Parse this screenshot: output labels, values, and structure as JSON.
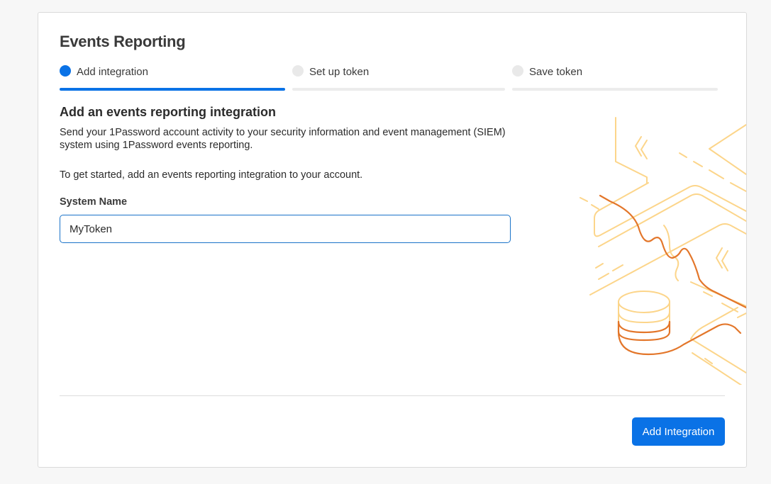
{
  "page": {
    "title": "Events Reporting"
  },
  "stepper": {
    "steps": [
      {
        "label": "Add integration",
        "state": "active"
      },
      {
        "label": "Set up token",
        "state": "pending"
      },
      {
        "label": "Save token",
        "state": "pending"
      }
    ]
  },
  "main": {
    "heading": "Add an events reporting integration",
    "description": "Send your 1Password account activity to your security information and event management (SIEM) system using 1Password events reporting.",
    "instruction": "To get started, add an events reporting integration to your account.",
    "system_name_label": "System Name",
    "system_name_value": "MyToken"
  },
  "footer": {
    "primary_button_label": "Add Integration"
  },
  "colors": {
    "accent": "#0a72e6",
    "illustration_light": "#fcd58a",
    "illustration_dark": "#e3762a"
  },
  "icons": {
    "illustration": "events-reporting-illustration"
  }
}
